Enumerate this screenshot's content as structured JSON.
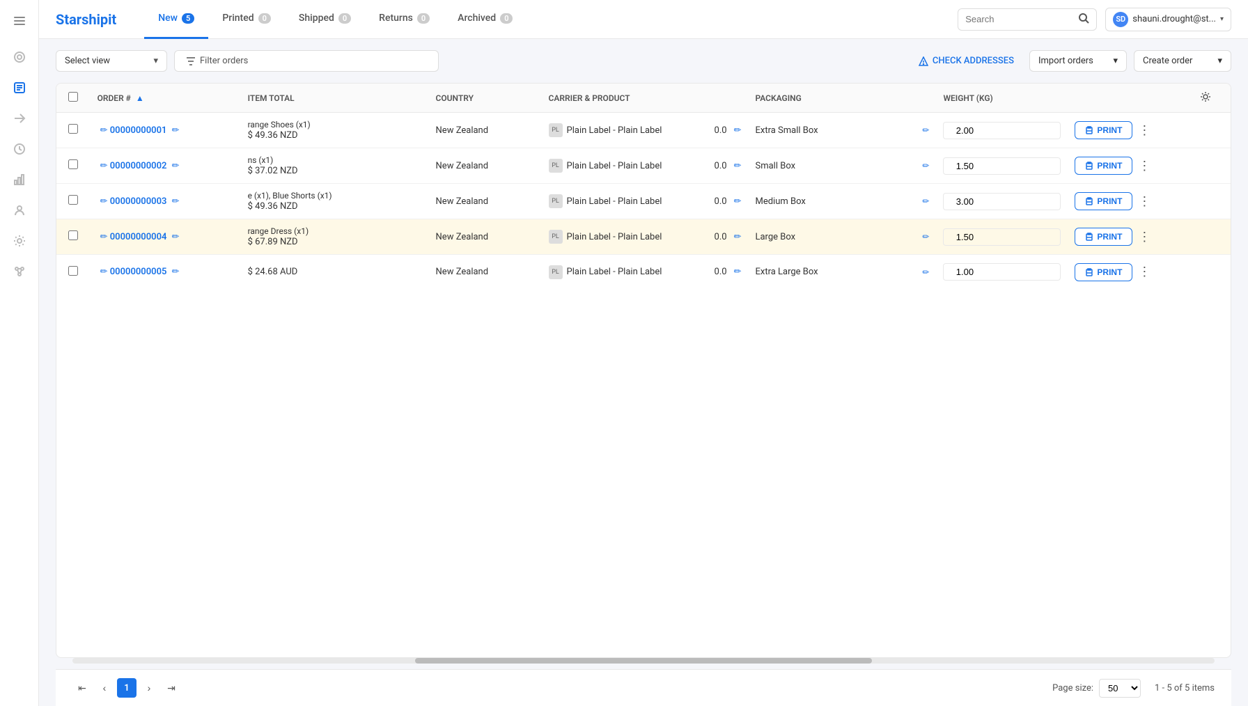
{
  "logo": {
    "text": "Starshipit"
  },
  "nav": {
    "tabs": [
      {
        "id": "new",
        "label": "New",
        "badge": "5",
        "active": true
      },
      {
        "id": "printed",
        "label": "Printed",
        "badge": "0",
        "active": false
      },
      {
        "id": "shipped",
        "label": "Shipped",
        "badge": "0",
        "active": false
      },
      {
        "id": "returns",
        "label": "Returns",
        "badge": "0",
        "active": false
      },
      {
        "id": "archived",
        "label": "Archived",
        "badge": "0",
        "active": false
      }
    ],
    "search_placeholder": "Search",
    "user_name": "shauni.drought@st...",
    "user_initials": "SD"
  },
  "toolbar": {
    "select_view_label": "Select view",
    "filter_label": "Filter orders",
    "check_addresses_label": "CHECK ADDRESSES",
    "import_orders_label": "Import orders",
    "create_order_label": "Create order"
  },
  "table": {
    "columns": [
      {
        "id": "order",
        "label": "ORDER #",
        "sortable": true
      },
      {
        "id": "item",
        "label": "ITEM TOTAL"
      },
      {
        "id": "country",
        "label": "COUNTRY"
      },
      {
        "id": "carrier",
        "label": "CARRIER & PRODUCT"
      },
      {
        "id": "packaging",
        "label": "PACKAGING"
      },
      {
        "id": "weight",
        "label": "WEIGHT (KG)"
      }
    ],
    "rows": [
      {
        "id": "row1",
        "order_num": "00000000001",
        "item_desc": "range Shoes (x1)",
        "item_total": "$ 49.36 NZD",
        "country": "New Zealand",
        "carrier": "Plain Label - Plain Label",
        "carrier_weight": "0.0",
        "packaging": "Extra Small Box",
        "weight": "2.00",
        "print_label": "PRINT",
        "highlighted": false
      },
      {
        "id": "row2",
        "order_num": "00000000002",
        "item_desc": "ns (x1)",
        "item_total": "$ 37.02 NZD",
        "country": "New Zealand",
        "carrier": "Plain Label - Plain Label",
        "carrier_weight": "0.0",
        "packaging": "Small Box",
        "weight": "1.50",
        "print_label": "PRINT",
        "highlighted": false
      },
      {
        "id": "row3",
        "order_num": "00000000003",
        "item_desc": "e (x1), Blue Shorts (x1)",
        "item_total": "$ 49.36 NZD",
        "country": "New Zealand",
        "carrier": "Plain Label - Plain Label",
        "carrier_weight": "0.0",
        "packaging": "Medium Box",
        "weight": "3.00",
        "print_label": "PRINT",
        "highlighted": false
      },
      {
        "id": "row4",
        "order_num": "00000000004",
        "item_desc": "range Dress (x1)",
        "item_total": "$ 67.89 NZD",
        "country": "New Zealand",
        "carrier": "Plain Label - Plain Label",
        "carrier_weight": "0.0",
        "packaging": "Large Box",
        "weight": "1.50",
        "print_label": "PRINT",
        "highlighted": true
      },
      {
        "id": "row5",
        "order_num": "00000000005",
        "item_desc": "",
        "item_total": "$ 24.68 AUD",
        "country": "New Zealand",
        "carrier": "Plain Label - Plain Label",
        "carrier_weight": "0.0",
        "packaging": "Extra Large Box",
        "weight": "1.00",
        "print_label": "PRINT",
        "highlighted": false
      }
    ]
  },
  "pagination": {
    "current_page": "1",
    "page_size_label": "Page size:",
    "page_size_value": "50",
    "page_info": "1 - 5 of 5 items"
  }
}
